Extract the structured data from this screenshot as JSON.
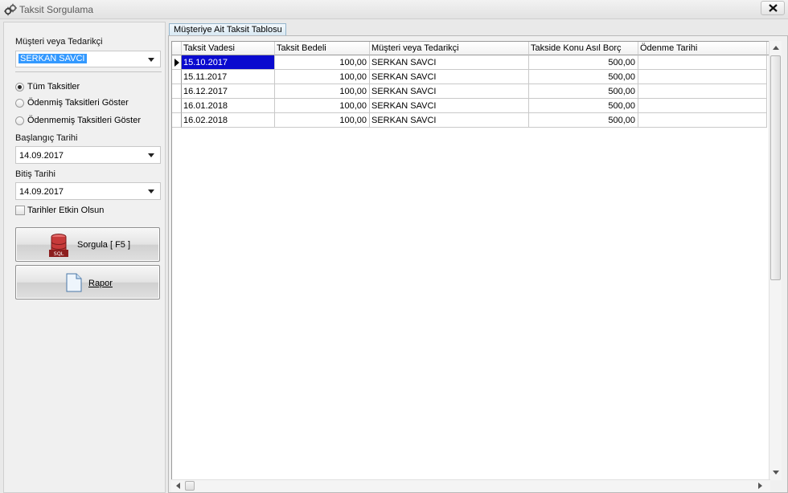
{
  "window": {
    "title": "Taksit Sorgulama"
  },
  "filters": {
    "customer_label": "Müşteri veya Tedarikçi",
    "customer_value": "SERKAN SAVCI",
    "radio_options": [
      {
        "label": "Tüm Taksitler",
        "selected": true
      },
      {
        "label": "Ödenmiş Taksitleri Göster",
        "selected": false
      },
      {
        "label": "Ödenmemiş Taksitleri Göster",
        "selected": false
      }
    ],
    "start_date_label": "Başlangıç Tarihi",
    "start_date_value": "14.09.2017",
    "end_date_label": "Bitiş Tarihi",
    "end_date_value": "14.09.2017",
    "dates_enabled_label": "Tarihler Etkin Olsun",
    "dates_enabled_checked": false
  },
  "buttons": {
    "query_label": "Sorgula [ F5 ]",
    "query_icon_text": "SQL",
    "report_label": "Rapor"
  },
  "tab": {
    "label": "Müşteriye Ait Taksit Tablosu"
  },
  "table": {
    "columns": [
      "Taksit Vadesi",
      "Taksit Bedeli",
      "Müşteri veya Tedarikçi",
      "Takside Konu Asıl Borç",
      "Ödenme Tarihi"
    ],
    "rows": [
      [
        "15.10.2017",
        "100,00",
        "SERKAN SAVCI",
        "500,00",
        ""
      ],
      [
        "15.11.2017",
        "100,00",
        "SERKAN SAVCI",
        "500,00",
        ""
      ],
      [
        "16.12.2017",
        "100,00",
        "SERKAN SAVCI",
        "500,00",
        ""
      ],
      [
        "16.01.2018",
        "100,00",
        "SERKAN SAVCI",
        "500,00",
        ""
      ],
      [
        "16.02.2018",
        "100,00",
        "SERKAN SAVCI",
        "500,00",
        ""
      ]
    ],
    "selected_row": 0
  },
  "colors": {
    "selection": "#0a0acf",
    "tab_border": "#94b5cc"
  }
}
